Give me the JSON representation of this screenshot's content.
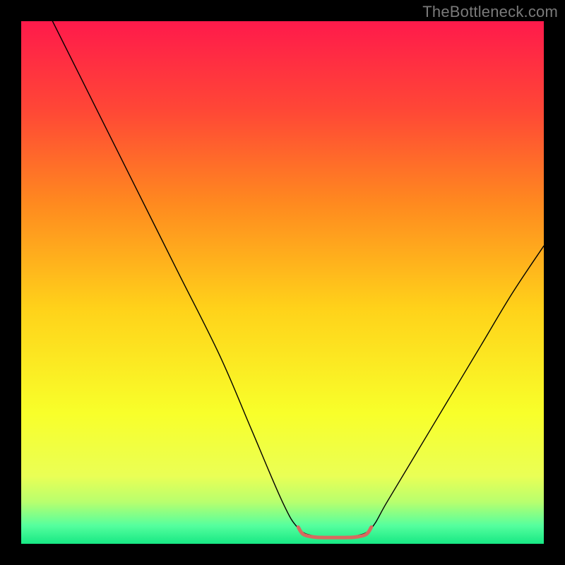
{
  "watermark": "TheBottleneck.com",
  "chart_data": {
    "type": "line",
    "title": "",
    "xlabel": "",
    "ylabel": "",
    "xlim": [
      0,
      100
    ],
    "ylim": [
      0,
      100
    ],
    "grid": false,
    "legend": false,
    "background_gradient_stops": [
      {
        "offset": 0.0,
        "color": "#ff1a4b"
      },
      {
        "offset": 0.17,
        "color": "#ff4736"
      },
      {
        "offset": 0.35,
        "color": "#ff8a1f"
      },
      {
        "offset": 0.55,
        "color": "#ffd21a"
      },
      {
        "offset": 0.75,
        "color": "#f8ff2a"
      },
      {
        "offset": 0.87,
        "color": "#eaff55"
      },
      {
        "offset": 0.92,
        "color": "#b8ff6e"
      },
      {
        "offset": 0.965,
        "color": "#55ff9e"
      },
      {
        "offset": 1.0,
        "color": "#17e884"
      }
    ],
    "series": [
      {
        "name": "bottleneck-curve",
        "stroke": "#000000",
        "stroke_width": 1.4,
        "points": [
          {
            "x": 6,
            "y": 100
          },
          {
            "x": 14,
            "y": 84
          },
          {
            "x": 22,
            "y": 68
          },
          {
            "x": 30,
            "y": 52
          },
          {
            "x": 38,
            "y": 36
          },
          {
            "x": 44,
            "y": 22
          },
          {
            "x": 50,
            "y": 8
          },
          {
            "x": 53,
            "y": 3
          },
          {
            "x": 56,
            "y": 1.5
          },
          {
            "x": 60,
            "y": 1.3
          },
          {
            "x": 64,
            "y": 1.5
          },
          {
            "x": 67,
            "y": 3
          },
          {
            "x": 70,
            "y": 8
          },
          {
            "x": 76,
            "y": 18
          },
          {
            "x": 82,
            "y": 28
          },
          {
            "x": 88,
            "y": 38
          },
          {
            "x": 94,
            "y": 48
          },
          {
            "x": 100,
            "y": 57
          }
        ]
      },
      {
        "name": "optimal-zone-marker",
        "stroke": "#d86a5f",
        "stroke_width": 5,
        "points": [
          {
            "x": 53,
            "y": 3.2
          },
          {
            "x": 54,
            "y": 1.8
          },
          {
            "x": 56,
            "y": 1.3
          },
          {
            "x": 58,
            "y": 1.2
          },
          {
            "x": 60,
            "y": 1.2
          },
          {
            "x": 62,
            "y": 1.2
          },
          {
            "x": 64,
            "y": 1.3
          },
          {
            "x": 66,
            "y": 1.8
          },
          {
            "x": 67,
            "y": 3.2
          }
        ]
      }
    ]
  }
}
